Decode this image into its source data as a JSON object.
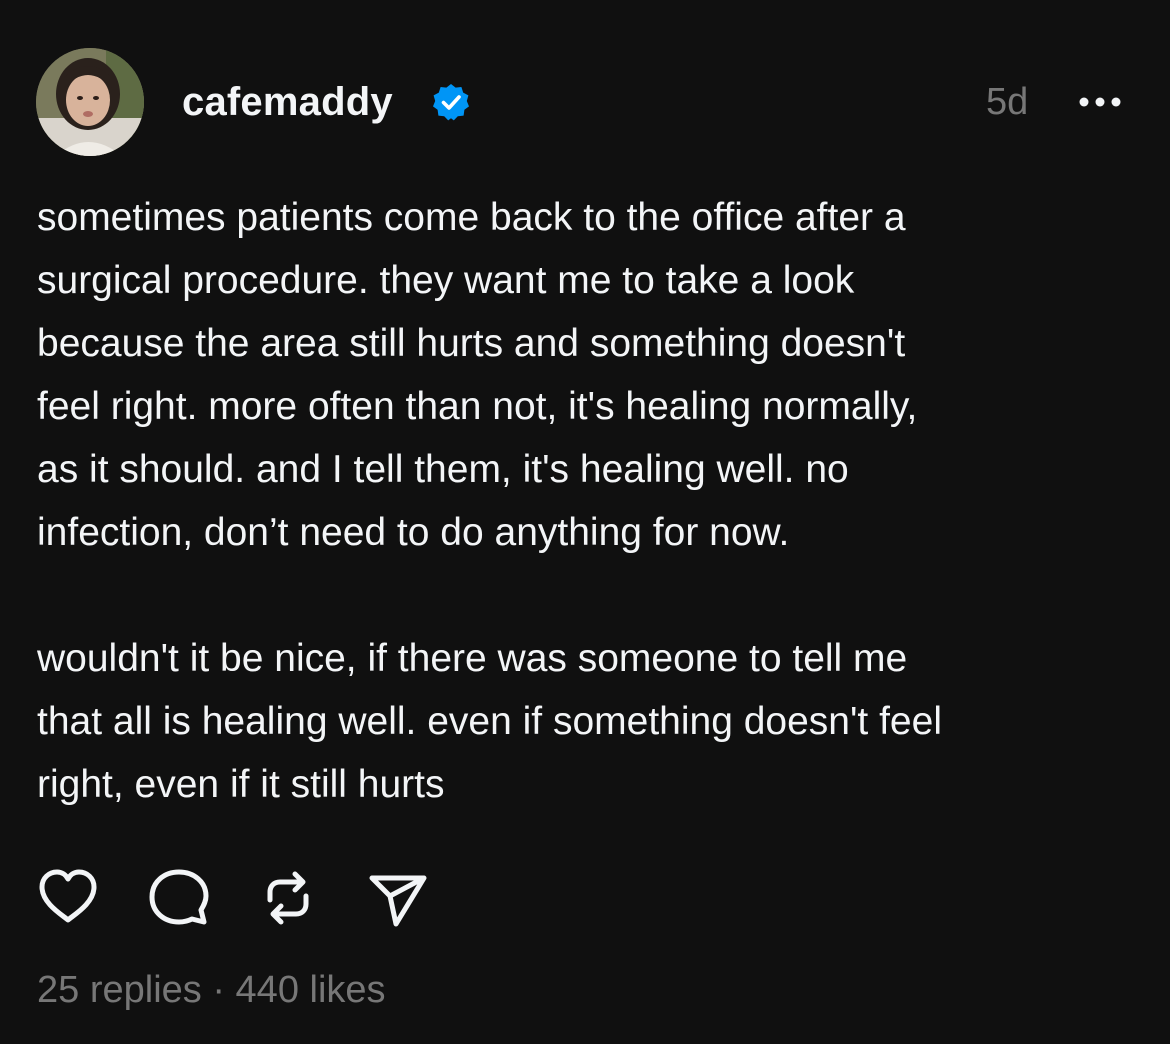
{
  "post": {
    "username": "cafemaddy",
    "verified": true,
    "timestamp": "5d",
    "paragraphs": [
      "sometimes patients come back to the office after a\nsurgical procedure. they want me to take a look\nbecause the area still hurts and something doesn't\nfeel right. more often than not, it's healing normally,\nas it should. and I tell them, it's healing well. no\ninfection, don’t need to do anything for now.\n\nwouldn't it be nice, if there was someone to tell me\nthat all is healing well. even if something doesn't feel\nright, even if it still hurts"
    ],
    "replies_label": "25 replies",
    "separator": "·",
    "likes_label": "440 likes"
  },
  "icons": {
    "verified": "verified-badge-icon",
    "more": "more-options-icon",
    "like": "heart-icon",
    "reply": "comment-icon",
    "repost": "repost-icon",
    "share": "send-icon"
  },
  "colors": {
    "background": "#101010",
    "text_primary": "#f3f5f7",
    "text_secondary": "#777777",
    "verified_blue": "#0095f6"
  }
}
